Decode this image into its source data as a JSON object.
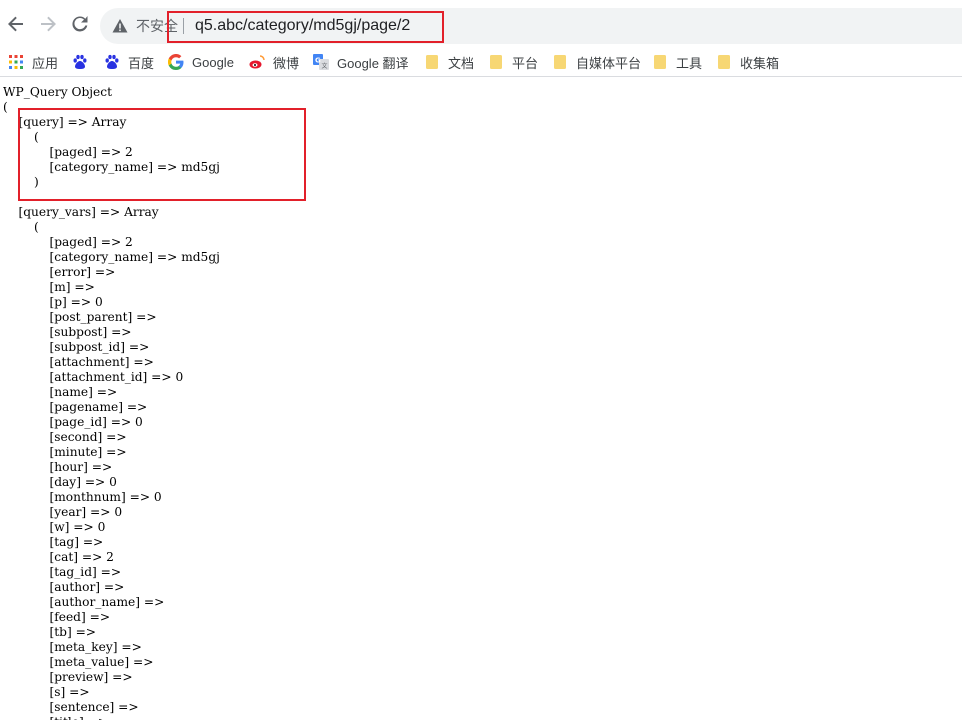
{
  "browser": {
    "security_label": "不安全",
    "url": "q5.abc/category/md5gj/page/2"
  },
  "bookmarks": [
    {
      "label": "应用",
      "icon": "apps-grid-icon"
    },
    {
      "label": "",
      "icon": "baidu-paw-icon"
    },
    {
      "label": "百度",
      "icon": "baidu-paw-icon"
    },
    {
      "label": "Google",
      "icon": "google-g-icon"
    },
    {
      "label": "微博",
      "icon": "weibo-icon"
    },
    {
      "label": "Google 翻译",
      "icon": "google-translate-icon"
    },
    {
      "label": "文档",
      "icon": "folder-icon"
    },
    {
      "label": "平台",
      "icon": "folder-icon"
    },
    {
      "label": "自媒体平台",
      "icon": "folder-icon"
    },
    {
      "label": "工具",
      "icon": "folder-icon"
    },
    {
      "label": "收集箱",
      "icon": "folder-icon"
    }
  ],
  "colors": {
    "highlight": "#e2202a",
    "folder": "#f7d774"
  },
  "output_lines": [
    "WP_Query Object",
    "(",
    "    [query] => Array",
    "        (",
    "            [paged] => 2",
    "            [category_name] => md5gj",
    "        )",
    "",
    "    [query_vars] => Array",
    "        (",
    "            [paged] => 2",
    "            [category_name] => md5gj",
    "            [error] => ",
    "            [m] => ",
    "            [p] => 0",
    "            [post_parent] => ",
    "            [subpost] => ",
    "            [subpost_id] => ",
    "            [attachment] => ",
    "            [attachment_id] => 0",
    "            [name] => ",
    "            [pagename] => ",
    "            [page_id] => 0",
    "            [second] => ",
    "            [minute] => ",
    "            [hour] => ",
    "            [day] => 0",
    "            [monthnum] => 0",
    "            [year] => 0",
    "            [w] => 0",
    "            [tag] => ",
    "            [cat] => 2",
    "            [tag_id] => ",
    "            [author] => ",
    "            [author_name] => ",
    "            [feed] => ",
    "            [tb] => ",
    "            [meta_key] => ",
    "            [meta_value] => ",
    "            [preview] => ",
    "            [s] => ",
    "            [sentence] => ",
    "            [title] => "
  ]
}
